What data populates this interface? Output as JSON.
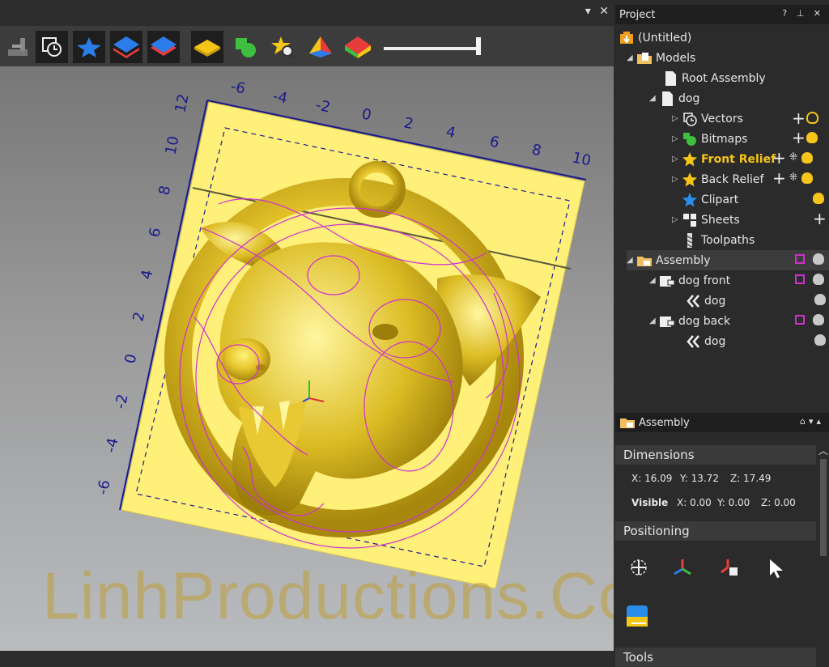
{
  "colors": {
    "relief": "#f0d43a",
    "material": "#fff07a",
    "vector": "#d02fd0",
    "axis": "#1a1a8c",
    "accent": "#f5c518"
  },
  "viewport": {
    "close_icon": "✕",
    "menu_icon": "▾",
    "toolbar": [
      "machine-icon",
      "clock-vector-icon",
      "star-relief-icon",
      "blue-layer-icon",
      "red-layer-icon",
      "yellow-plate-icon",
      "bitmap-icon",
      "clipart-search-icon",
      "pyramid-icon",
      "color-pyramid-icon"
    ],
    "ruler_top": [
      "-6",
      "-4",
      "-2",
      "0",
      "2",
      "4",
      "6",
      "8",
      "10"
    ],
    "ruler_left": [
      "12",
      "10",
      "8",
      "6",
      "4",
      "2",
      "0",
      "-2",
      "-4",
      "-6"
    ],
    "watermark": "LinhProductions.Com"
  },
  "project": {
    "title": "Project",
    "controls": "? ⊥ ✕",
    "tree": [
      {
        "label": "(Untitled)",
        "indent": 0
      },
      {
        "label": "Models",
        "indent": 1
      },
      {
        "label": "Root Assembly",
        "indent": 2
      },
      {
        "label": "dog",
        "indent": 2
      },
      {
        "label": "Vectors",
        "indent": 3
      },
      {
        "label": "Bitmaps",
        "indent": 3
      },
      {
        "label": "Front Relief",
        "indent": 3
      },
      {
        "label": "Back Relief",
        "indent": 3
      },
      {
        "label": "Clipart",
        "indent": 3
      },
      {
        "label": "Sheets",
        "indent": 3
      },
      {
        "label": "Toolpaths",
        "indent": 3
      },
      {
        "label": "Assembly",
        "indent": 0
      },
      {
        "label": "dog front",
        "indent": 1
      },
      {
        "label": "dog",
        "indent": 2
      },
      {
        "label": "dog back",
        "indent": 1
      },
      {
        "label": "dog",
        "indent": 2
      }
    ]
  },
  "assembly": {
    "title": "Assembly",
    "dimensions_label": "Dimensions",
    "dims": {
      "x": "X: 16.09",
      "y": "Y: 13.72",
      "z": "Z: 17.49"
    },
    "visible": {
      "label": "Visible",
      "x": "X: 0.00",
      "y": "Y: 0.00",
      "z": "Z: 0.00"
    },
    "positioning_label": "Positioning",
    "tools_label": "Tools"
  }
}
